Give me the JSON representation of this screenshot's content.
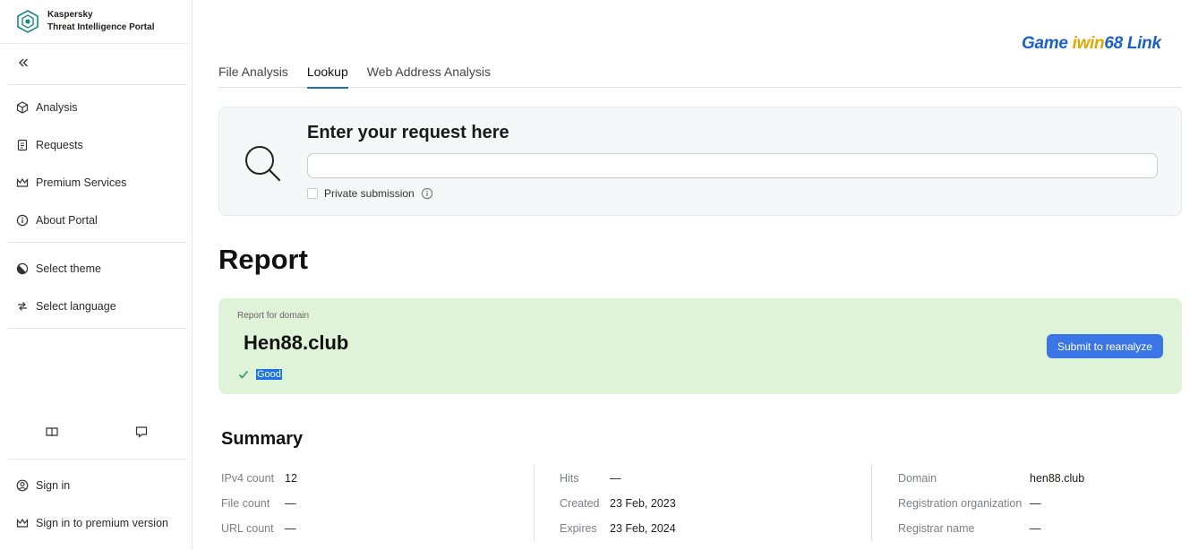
{
  "brand": {
    "line1": "Kaspersky",
    "line2": "Threat Intelligence Portal"
  },
  "sidebar": {
    "items": [
      {
        "label": "Analysis",
        "icon": "cube-icon"
      },
      {
        "label": "Requests",
        "icon": "document-icon"
      },
      {
        "label": "Premium Services",
        "icon": "crown-icon"
      },
      {
        "label": "About Portal",
        "icon": "info-icon"
      }
    ],
    "settings": [
      {
        "label": "Select theme",
        "icon": "theme-icon"
      },
      {
        "label": "Select language",
        "icon": "language-icon"
      }
    ],
    "account": [
      {
        "label": "Sign in",
        "icon": "user-icon"
      },
      {
        "label": "Sign in to premium version",
        "icon": "crown-icon"
      }
    ]
  },
  "tabs": [
    {
      "label": "File Analysis",
      "active": false
    },
    {
      "label": "Lookup",
      "active": true
    },
    {
      "label": "Web Address Analysis",
      "active": false
    }
  ],
  "search": {
    "title": "Enter your request here",
    "value": "",
    "placeholder": "",
    "private_label": "Private submission"
  },
  "report": {
    "title": "Report",
    "subtitle": "Report for domain",
    "domain": "Hen88.club",
    "status": "Good",
    "reanalyze_label": "Submit to reanalyze"
  },
  "summary": {
    "title": "Summary",
    "col1": [
      {
        "label": "IPv4 count",
        "value": "12"
      },
      {
        "label": "File count",
        "value": "—"
      },
      {
        "label": "URL count",
        "value": "—"
      }
    ],
    "col2": [
      {
        "label": "Hits",
        "value": "—"
      },
      {
        "label": "Created",
        "value": "23 Feb, 2023"
      },
      {
        "label": "Expires",
        "value": "23 Feb, 2024"
      }
    ],
    "col3": [
      {
        "label": "Domain",
        "value": "hen88.club"
      },
      {
        "label": "Registration organization",
        "value": "—"
      },
      {
        "label": "Registrar name",
        "value": "—"
      }
    ]
  },
  "watermark": {
    "left": "Game ",
    "middle": "iwin",
    "right": "68 Link"
  },
  "colors": {
    "accent": "#1d6fb8",
    "button": "#3b76e6",
    "report_bg": "#dff3d9",
    "good": "#1f9d55"
  }
}
